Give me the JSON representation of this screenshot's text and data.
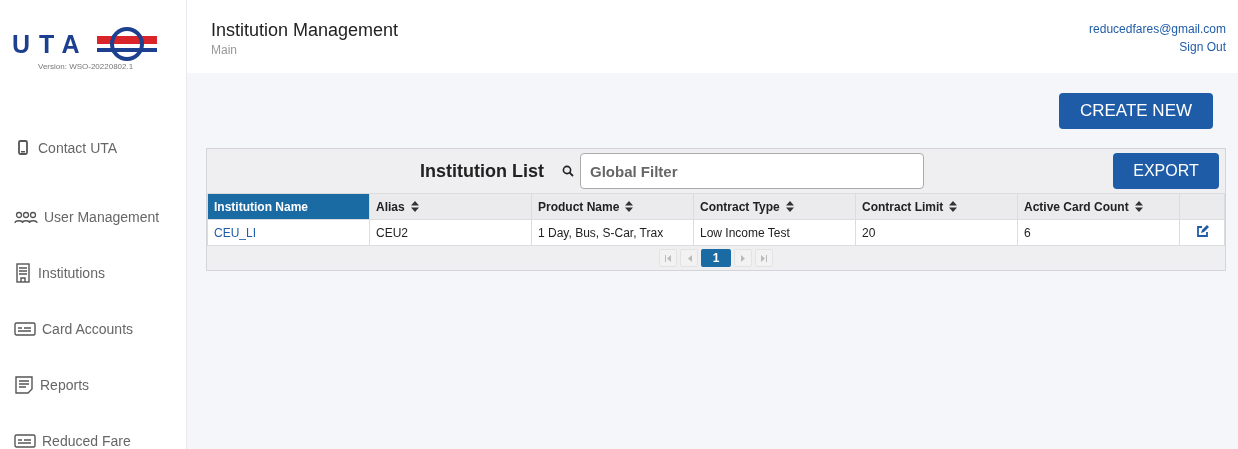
{
  "logo": {
    "text": "UTA",
    "version": "Version: WSO-20220802.1"
  },
  "sidebar": {
    "items": [
      {
        "label": "Contact UTA",
        "kind": "phone"
      },
      {
        "label": "User Management",
        "kind": "users"
      },
      {
        "label": "Institutions",
        "kind": "building"
      },
      {
        "label": "Card Accounts",
        "kind": "card"
      },
      {
        "label": "Reports",
        "kind": "report"
      },
      {
        "label": "Reduced Fare",
        "kind": "card"
      }
    ]
  },
  "header": {
    "title": "Institution Management",
    "subtitle": "Main",
    "user_email": "reducedfares@gmail.com",
    "sign_out": "Sign Out"
  },
  "create_button": "CREATE NEW",
  "table": {
    "title": "Institution List",
    "filter": {
      "placeholder": "Global Filter"
    },
    "export_button": "EXPORT",
    "columns": [
      {
        "label": "Institution Name",
        "sorted": true
      },
      {
        "label": "Alias",
        "sorted": false
      },
      {
        "label": "Product Name",
        "sorted": false
      },
      {
        "label": "Contract Type",
        "sorted": false
      },
      {
        "label": "Contract Limit",
        "sorted": false
      },
      {
        "label": "Active Card Count",
        "sorted": false
      }
    ],
    "rows": [
      {
        "cells": [
          "CEU_LI",
          "CEU2",
          "1 Day, Bus, S-Car, Trax",
          "Low Income Test",
          "20",
          "6"
        ]
      }
    ],
    "pagination": {
      "pages": [
        {
          "label": "1",
          "selected": true
        }
      ]
    }
  }
}
